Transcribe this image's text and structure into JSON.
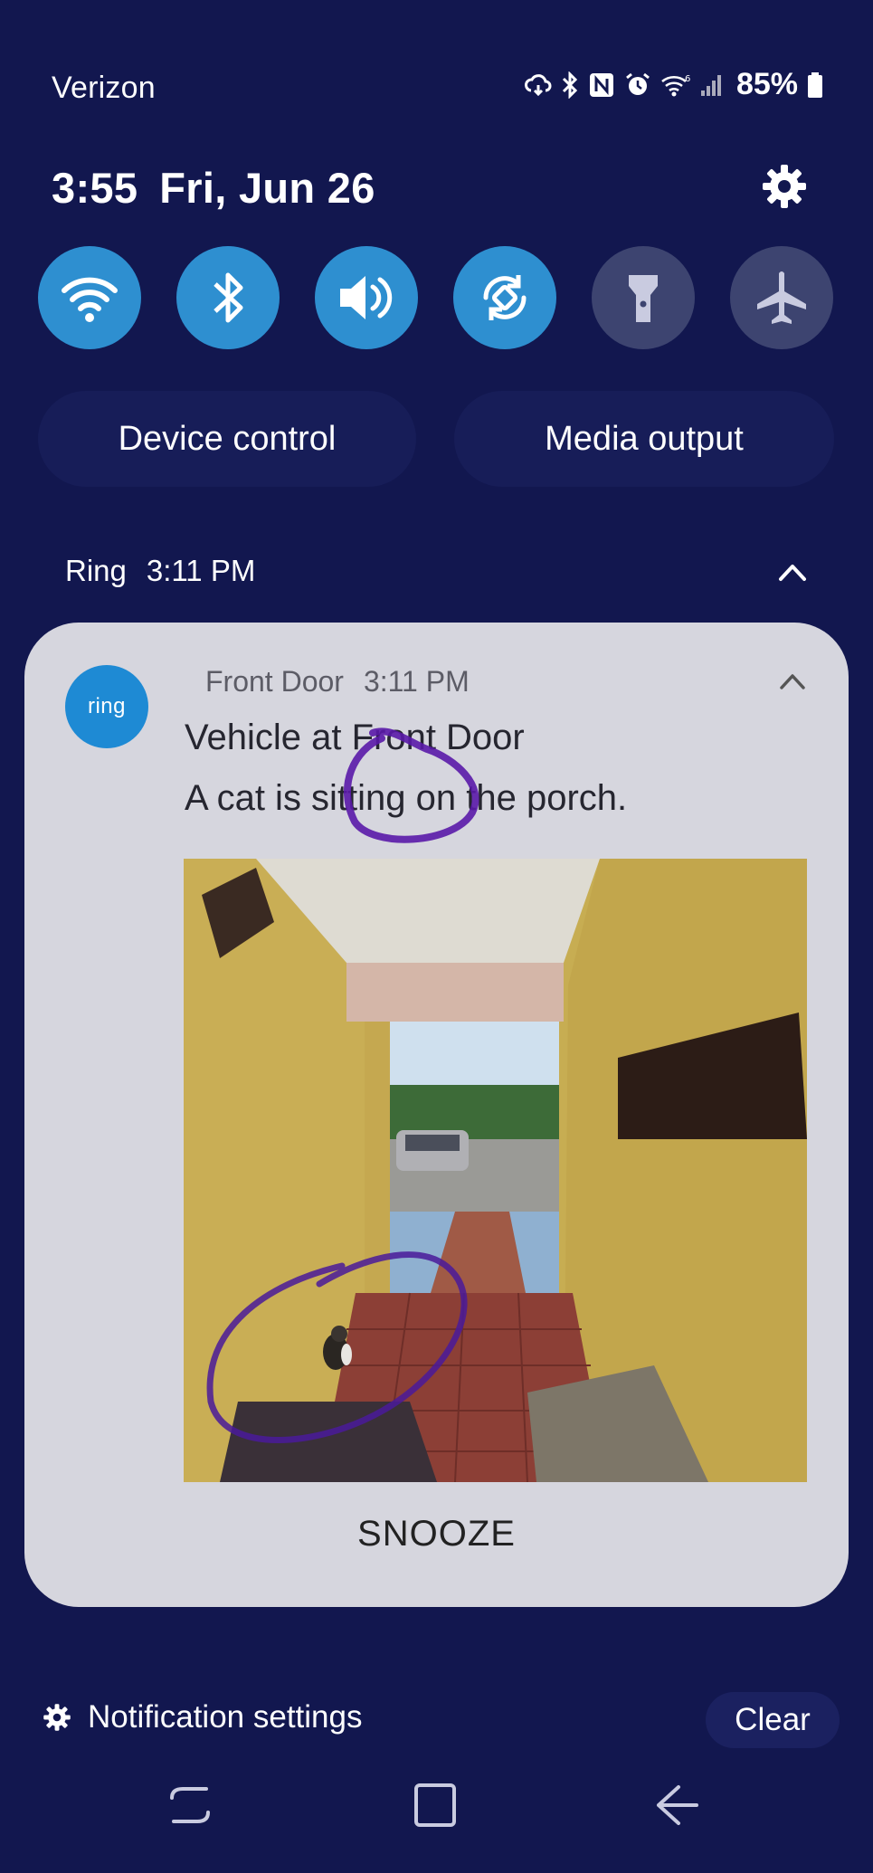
{
  "status_bar": {
    "carrier": "Verizon",
    "battery": "85%",
    "icons": [
      "cloud-sync-icon",
      "bluetooth-icon",
      "nfc-icon",
      "alarm-icon",
      "wifi-icon",
      "signal-icon",
      "battery-icon"
    ]
  },
  "header": {
    "time": "3:55",
    "date": "Fri, Jun 26"
  },
  "quick_toggles": [
    {
      "name": "wifi",
      "state": "on"
    },
    {
      "name": "bluetooth",
      "state": "on"
    },
    {
      "name": "sound",
      "state": "on"
    },
    {
      "name": "auto-rotate",
      "state": "on"
    },
    {
      "name": "flashlight",
      "state": "off"
    },
    {
      "name": "airplane-mode",
      "state": "off"
    }
  ],
  "pills": {
    "device_control": "Device control",
    "media_output": "Media output"
  },
  "notification_group": {
    "app": "Ring",
    "time": "3:11 PM"
  },
  "notification": {
    "logo_text": "ring",
    "source": "Front Door",
    "time": "3:11 PM",
    "title": "Vehicle at Front Door",
    "body": "A cat is sitting on the porch.",
    "action": "SNOOZE"
  },
  "footer": {
    "settings_label": "Notification settings",
    "clear_label": "Clear"
  },
  "colors": {
    "background": "#12174f",
    "toggle_on": "#2e8fd0",
    "toggle_off": "#3d4470",
    "card": "#d6d6de",
    "annotation": "#5a1aa8"
  }
}
